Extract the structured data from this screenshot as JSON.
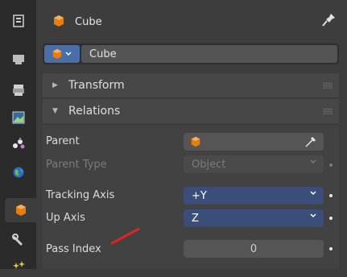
{
  "header": {
    "title": "Cube"
  },
  "object_selector": {
    "name": "Cube"
  },
  "panels": {
    "transform": {
      "label": "Transform"
    },
    "relations": {
      "label": "Relations"
    }
  },
  "rows": {
    "parent": {
      "label": "Parent"
    },
    "parent_type": {
      "label": "Parent Type",
      "value": "Object"
    },
    "tracking_axis": {
      "label": "Tracking Axis",
      "value": "+Y"
    },
    "up_axis": {
      "label": "Up Axis",
      "value": "Z"
    },
    "pass_index": {
      "label": "Pass Index",
      "value": "0"
    }
  },
  "sidebar": {
    "items": [
      "tool-icon",
      "render-icon",
      "output-icon",
      "view-layer-icon",
      "scene-icon",
      "world-icon",
      "object-icon",
      "modifier-icon",
      "particles-icon"
    ]
  },
  "colors": {
    "accent_blue": "#3b4e7a",
    "object_orange": "#e87d0d",
    "annotation_red": "#e32222"
  }
}
